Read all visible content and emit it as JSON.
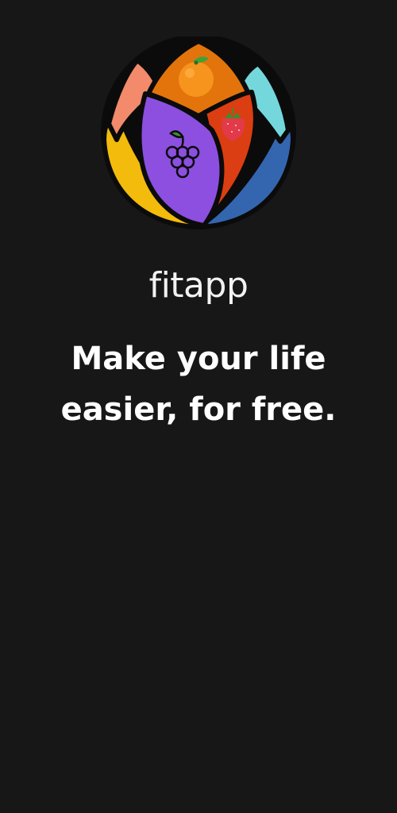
{
  "app": {
    "name": "fitapp",
    "tagline_line1": "Make your life",
    "tagline_line2": "easier, for free."
  },
  "logo": {
    "icons": [
      "orange-icon",
      "strawberry-icon",
      "grapes-icon"
    ],
    "colors": {
      "background": "#171717",
      "outline": "#0b0b0b",
      "salmon": "#f28a6b",
      "orange": "#e3740c",
      "yellow": "#f3bb0b",
      "purple": "#8c4fe0",
      "red": "#db3e12",
      "cyan": "#74d7dc",
      "blue": "#3466b0"
    }
  }
}
